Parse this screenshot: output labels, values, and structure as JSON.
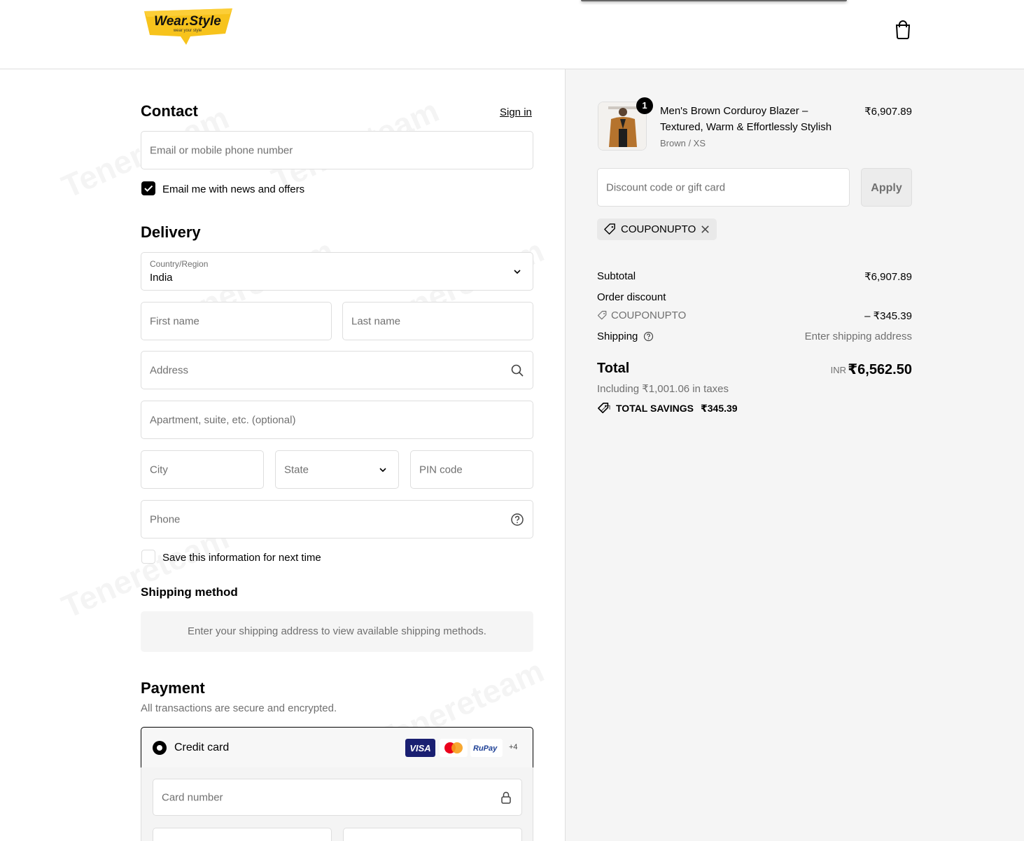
{
  "header": {
    "logo_text": "Wear.Style",
    "logo_tagline": "wear your style"
  },
  "contact": {
    "title": "Contact",
    "sign_in": "Sign in",
    "email_placeholder": "Email or mobile phone number",
    "news_checkbox_label": "Email me with news and offers",
    "news_checked": true
  },
  "delivery": {
    "title": "Delivery",
    "country_label": "Country/Region",
    "country_value": "India",
    "first_name": "First name",
    "last_name": "Last name",
    "address": "Address",
    "apartment": "Apartment, suite, etc. (optional)",
    "city": "City",
    "state": "State",
    "pin": "PIN code",
    "phone": "Phone",
    "save_info_label": "Save this information for next time",
    "save_info_checked": false
  },
  "shipping_method": {
    "title": "Shipping method",
    "message": "Enter your shipping address to view available shipping methods."
  },
  "payment": {
    "title": "Payment",
    "subtitle": "All transactions are secure and encrypted.",
    "method_label": "Credit card",
    "card_logos": [
      "VISA",
      "Mastercard",
      "RuPay"
    ],
    "more_logos": "+4",
    "card_number_placeholder": "Card number"
  },
  "summary": {
    "product": {
      "name_line1": "Men's Brown Corduroy Blazer –",
      "name_line2": "Textured, Warm & Effortlessly Stylish",
      "variant": "Brown / XS",
      "price": "₹6,907.89",
      "quantity": "1"
    },
    "discount_placeholder": "Discount code or gift card",
    "apply_label": "Apply",
    "applied_coupon": "COUPONUPTO",
    "subtotal_label": "Subtotal",
    "subtotal_value": "₹6,907.89",
    "order_discount_label": "Order discount",
    "discount_code": "COUPONUPTO",
    "discount_value": "– ₹345.39",
    "shipping_label": "Shipping",
    "shipping_value": "Enter shipping address",
    "total_label": "Total",
    "currency": "INR",
    "total_value": "₹6,562.50",
    "taxes_note": "Including ₹1,001.06 in taxes",
    "total_savings_label": "TOTAL SAVINGS",
    "total_savings_value": "₹345.39"
  },
  "watermark": "Tenereteam",
  "colors": {
    "brand_yellow": "#f7c31c",
    "summary_bg": "#f5f5f5",
    "border": "#dedede",
    "muted_text": "#707070",
    "visa_blue": "#1a1f71"
  }
}
